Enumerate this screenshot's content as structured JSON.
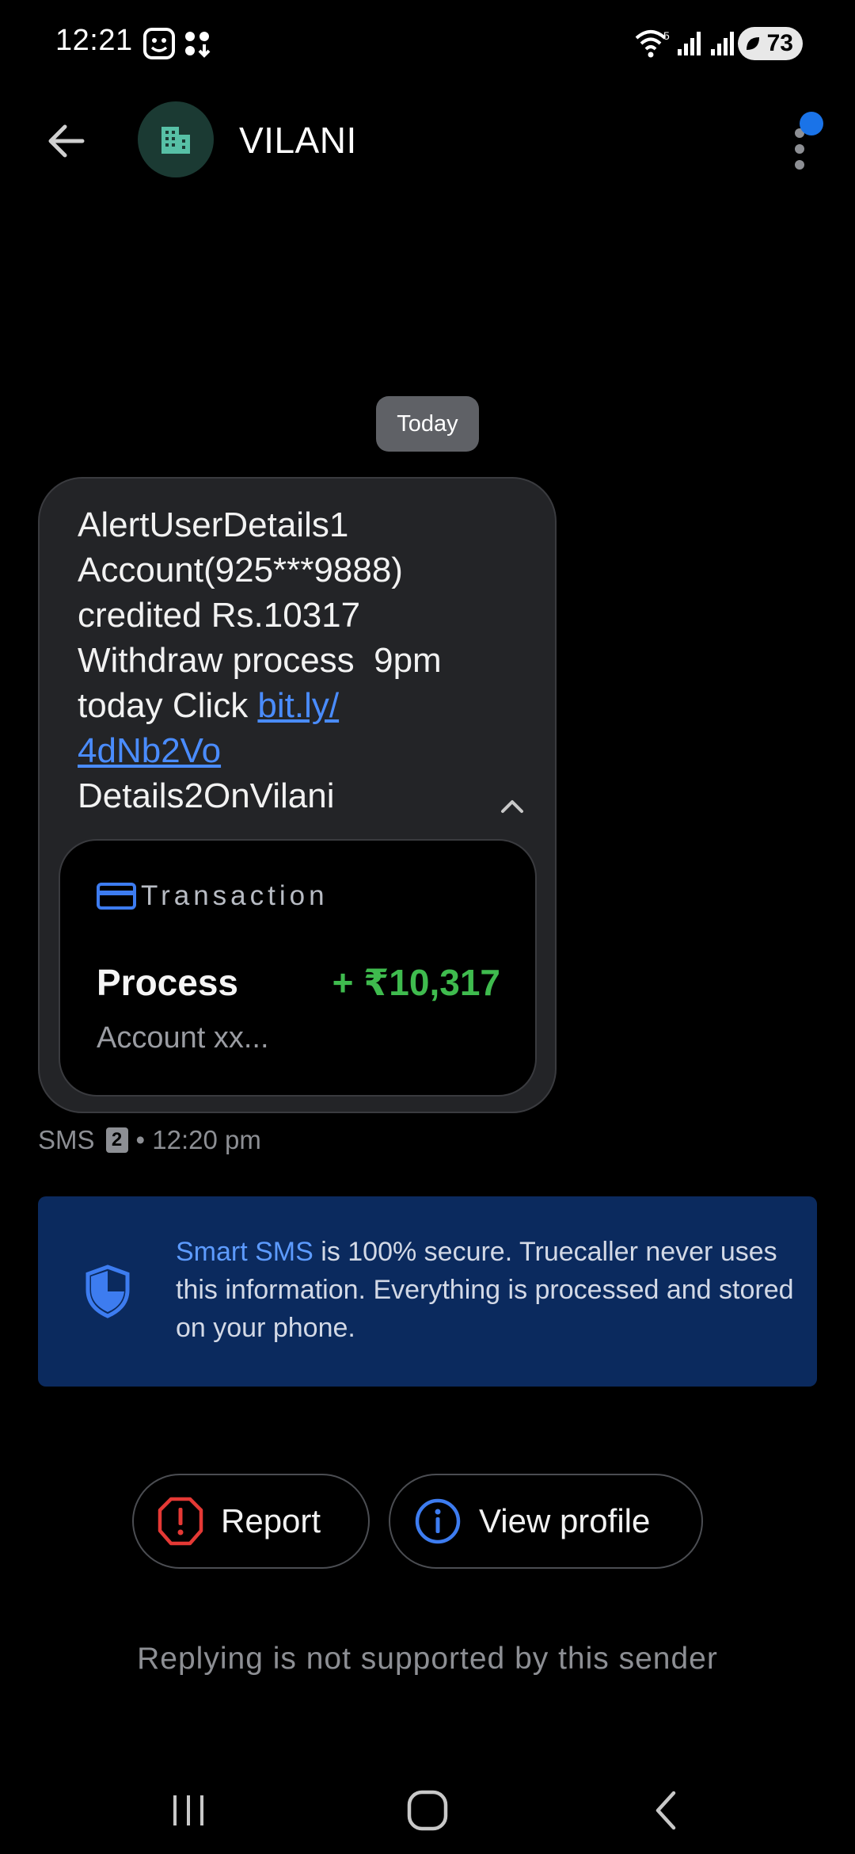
{
  "status_bar": {
    "time": "12:21",
    "battery": "73",
    "wifi_label": "5"
  },
  "header": {
    "sender_name": "VILANI"
  },
  "conversation": {
    "date_chip": "Today",
    "message": {
      "text_before_link": "AlertUserDetails1\nAccount(925***9888)\ncredited Rs.10317\nWithdraw process  9pm\ntoday Click ",
      "link": "bit.ly/\n4dNb2Vo",
      "text_after_link": "\nDetails2OnVilani"
    },
    "transaction_card": {
      "title": "Transaction",
      "name": "Process",
      "amount": "+ ₹10,317",
      "account": "Account xx..."
    },
    "meta": {
      "channel": "SMS",
      "sim": "2",
      "time": "• 12:20 pm"
    }
  },
  "info_box": {
    "highlight": "Smart SMS",
    "text": " is 100% secure. Truecaller never uses this information. Everything is processed and stored on your phone."
  },
  "actions": {
    "report_label": "Report",
    "view_profile_label": "View profile"
  },
  "footer": {
    "reply_note": "Replying is not supported by this sender"
  },
  "colors": {
    "accent_blue": "#1a73e8",
    "amount_green": "#3fbb4e",
    "report_red": "#e53935",
    "info_bg": "#0b2a5e"
  }
}
